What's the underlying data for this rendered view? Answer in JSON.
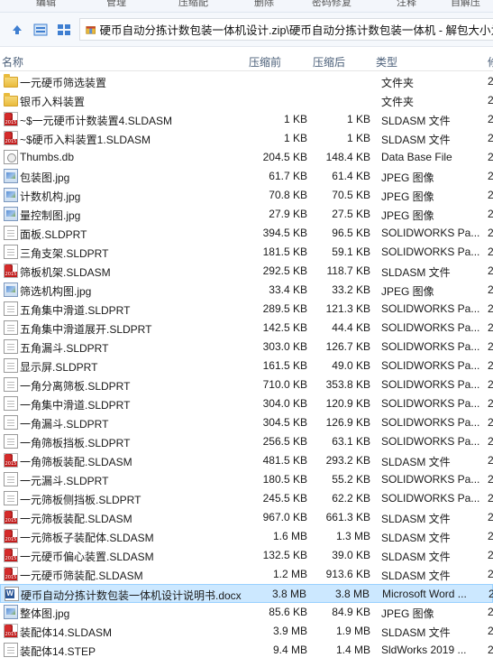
{
  "toolbar_fragments": [
    "编辑",
    "管理",
    "压缩配",
    "删除",
    "密码修复",
    "注释",
    "自解压"
  ],
  "address": {
    "path": "硬币自动分拣计数包装一体机设计.zip\\硬币自动分拣计数包装一体机 - 解包大小为"
  },
  "columns": {
    "name": "名称",
    "compressed": "压缩前",
    "original": "压缩后",
    "type": "类型"
  },
  "files": [
    {
      "name": "一元硬币筛选装置",
      "compressed": "",
      "original": "",
      "type": "文件夹",
      "icon": "folder-icon",
      "extra": "2"
    },
    {
      "name": "银币入料装置",
      "compressed": "",
      "original": "",
      "type": "文件夹",
      "icon": "folder-icon",
      "extra": "2"
    },
    {
      "name": "~$一元硬币计数装置4.SLDASM",
      "compressed": "1 KB",
      "original": "1 KB",
      "type": "SLDASM 文件",
      "icon": "solidworks-icon",
      "extra": "2"
    },
    {
      "name": "~$硬币入料装置1.SLDASM",
      "compressed": "1 KB",
      "original": "1 KB",
      "type": "SLDASM 文件",
      "icon": "solidworks-icon",
      "extra": "2"
    },
    {
      "name": "Thumbs.db",
      "compressed": "204.5 KB",
      "original": "148.4 KB",
      "type": "Data Base File",
      "icon": "database-icon",
      "extra": "2"
    },
    {
      "name": "包装图.jpg",
      "compressed": "61.7 KB",
      "original": "61.4 KB",
      "type": "JPEG 图像",
      "icon": "image-icon",
      "extra": "2"
    },
    {
      "name": "计数机构.jpg",
      "compressed": "70.8 KB",
      "original": "70.5 KB",
      "type": "JPEG 图像",
      "icon": "image-icon",
      "extra": "2"
    },
    {
      "name": "量控制图.jpg",
      "compressed": "27.9 KB",
      "original": "27.5 KB",
      "type": "JPEG 图像",
      "icon": "image-icon",
      "extra": "2"
    },
    {
      "name": "面板.SLDPRT",
      "compressed": "394.5 KB",
      "original": "96.5 KB",
      "type": "SOLIDWORKS Pa...",
      "icon": "document-icon",
      "extra": "2"
    },
    {
      "name": "三角支架.SLDPRT",
      "compressed": "181.5 KB",
      "original": "59.1 KB",
      "type": "SOLIDWORKS Pa...",
      "icon": "document-icon",
      "extra": "2"
    },
    {
      "name": "筛板机架.SLDASM",
      "compressed": "292.5 KB",
      "original": "118.7 KB",
      "type": "SLDASM 文件",
      "icon": "solidworks-icon",
      "extra": "2"
    },
    {
      "name": "筛选机构图.jpg",
      "compressed": "33.4 KB",
      "original": "33.2 KB",
      "type": "JPEG 图像",
      "icon": "image-icon",
      "extra": "2"
    },
    {
      "name": "五角集中滑道.SLDPRT",
      "compressed": "289.5 KB",
      "original": "121.3 KB",
      "type": "SOLIDWORKS Pa...",
      "icon": "document-icon",
      "extra": "2"
    },
    {
      "name": "五角集中滑道展开.SLDPRT",
      "compressed": "142.5 KB",
      "original": "44.4 KB",
      "type": "SOLIDWORKS Pa...",
      "icon": "document-icon",
      "extra": "2"
    },
    {
      "name": "五角漏斗.SLDPRT",
      "compressed": "303.0 KB",
      "original": "126.7 KB",
      "type": "SOLIDWORKS Pa...",
      "icon": "document-icon",
      "extra": "2"
    },
    {
      "name": "显示屏.SLDPRT",
      "compressed": "161.5 KB",
      "original": "49.0 KB",
      "type": "SOLIDWORKS Pa...",
      "icon": "document-icon",
      "extra": "2"
    },
    {
      "name": "一角分离筛板.SLDPRT",
      "compressed": "710.0 KB",
      "original": "353.8 KB",
      "type": "SOLIDWORKS Pa...",
      "icon": "document-icon",
      "extra": "2"
    },
    {
      "name": "一角集中滑道.SLDPRT",
      "compressed": "304.0 KB",
      "original": "120.9 KB",
      "type": "SOLIDWORKS Pa...",
      "icon": "document-icon",
      "extra": "2"
    },
    {
      "name": "一角漏斗.SLDPRT",
      "compressed": "304.5 KB",
      "original": "126.9 KB",
      "type": "SOLIDWORKS Pa...",
      "icon": "document-icon",
      "extra": "2"
    },
    {
      "name": "一角筛板挡板.SLDPRT",
      "compressed": "256.5 KB",
      "original": "63.1 KB",
      "type": "SOLIDWORKS Pa...",
      "icon": "document-icon",
      "extra": "2"
    },
    {
      "name": "一角筛板装配.SLDASM",
      "compressed": "481.5 KB",
      "original": "293.2 KB",
      "type": "SLDASM 文件",
      "icon": "solidworks-icon",
      "extra": "2"
    },
    {
      "name": "一元漏斗.SLDPRT",
      "compressed": "180.5 KB",
      "original": "55.2 KB",
      "type": "SOLIDWORKS Pa...",
      "icon": "document-icon",
      "extra": "2"
    },
    {
      "name": "一元筛板侧挡板.SLDPRT",
      "compressed": "245.5 KB",
      "original": "62.2 KB",
      "type": "SOLIDWORKS Pa...",
      "icon": "document-icon",
      "extra": "2"
    },
    {
      "name": "一元筛板装配.SLDASM",
      "compressed": "967.0 KB",
      "original": "661.3 KB",
      "type": "SLDASM 文件",
      "icon": "solidworks-icon",
      "extra": "2"
    },
    {
      "name": "一元筛板子装配体.SLDASM",
      "compressed": "1.6 MB",
      "original": "1.3 MB",
      "type": "SLDASM 文件",
      "icon": "solidworks-icon",
      "extra": "2"
    },
    {
      "name": "一元硬币偏心装置.SLDASM",
      "compressed": "132.5 KB",
      "original": "39.0 KB",
      "type": "SLDASM 文件",
      "icon": "solidworks-icon",
      "extra": "2"
    },
    {
      "name": "一元硬币筛装配.SLDASM",
      "compressed": "1.2 MB",
      "original": "913.6 KB",
      "type": "SLDASM 文件",
      "icon": "solidworks-icon",
      "extra": "2"
    },
    {
      "name": "硬币自动分拣计数包装一体机设计说明书.docx",
      "compressed": "3.8 MB",
      "original": "3.8 MB",
      "type": "Microsoft Word ...",
      "icon": "word-icon",
      "extra": "2",
      "selected": true
    },
    {
      "name": "整体图.jpg",
      "compressed": "85.6 KB",
      "original": "84.9 KB",
      "type": "JPEG 图像",
      "icon": "image-icon",
      "extra": "2"
    },
    {
      "name": "装配体14.SLDASM",
      "compressed": "3.9 MB",
      "original": "1.9 MB",
      "type": "SLDASM 文件",
      "icon": "solidworks-icon",
      "extra": "2"
    },
    {
      "name": "装配体14.STEP",
      "compressed": "9.4 MB",
      "original": "1.4 MB",
      "type": "SldWorks 2019 ...",
      "icon": "document-icon",
      "extra": "2"
    }
  ],
  "colors": {
    "selection_bg": "#cce8ff",
    "selection_border": "#99d1ff",
    "header_text": "#4c607a"
  }
}
